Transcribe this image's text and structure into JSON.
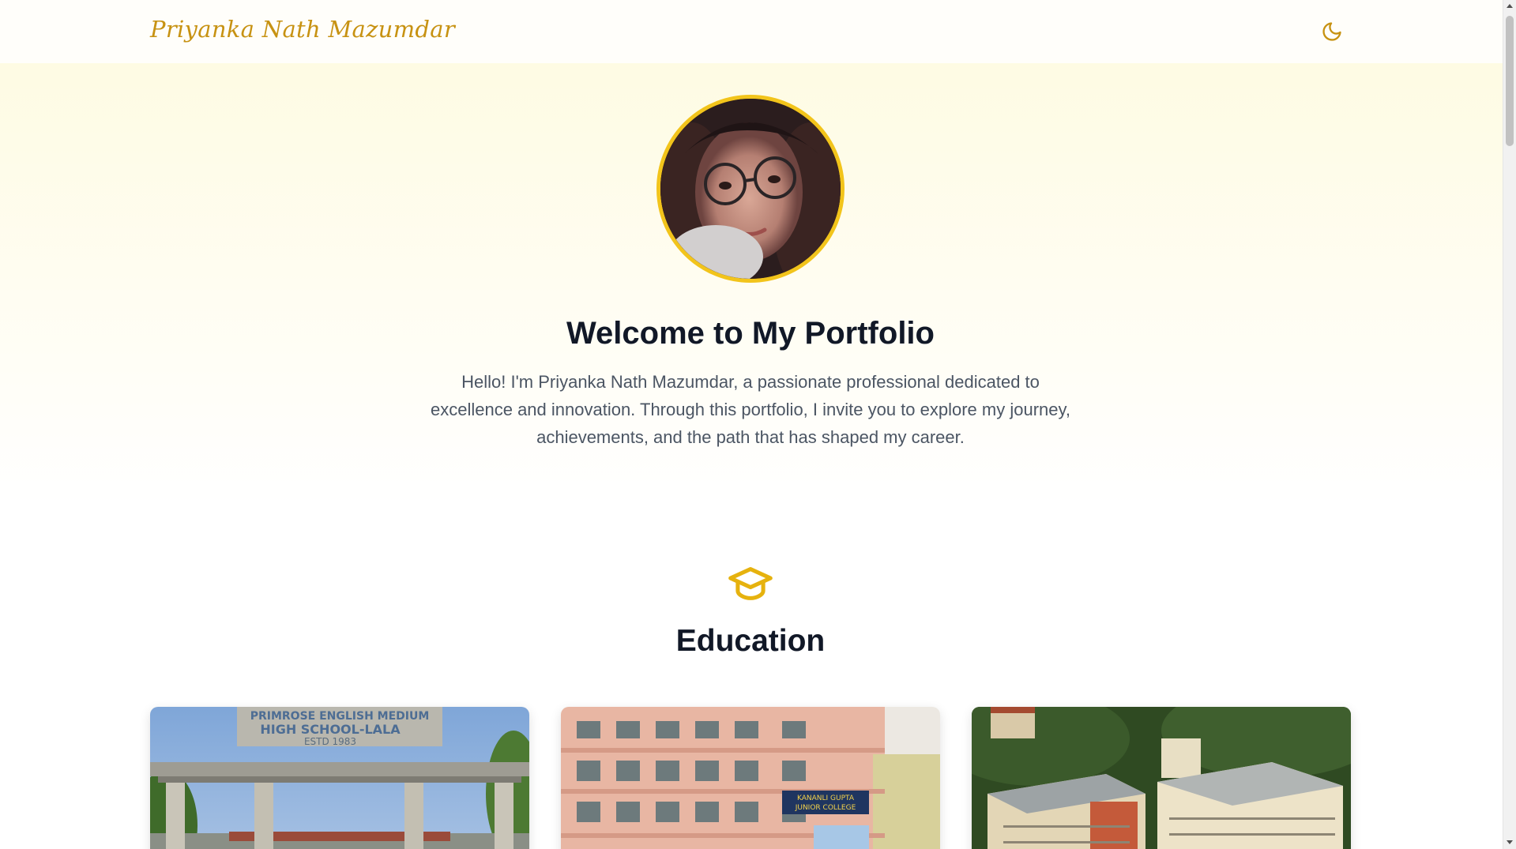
{
  "header": {
    "brand": "Priyanka Nath Mazumdar",
    "theme_toggle_icon": "moon-icon"
  },
  "hero": {
    "avatar_icon": "profile-photo",
    "title": "Welcome to My Portfolio",
    "intro": "Hello! I'm Priyanka Nath Mazumdar, a passionate professional dedicated to excellence and innovation. Through this portfolio, I invite you to explore my journey, achievements, and the path that has shaped my career."
  },
  "education": {
    "icon": "graduation-cap-icon",
    "title": "Education",
    "cards": [
      {
        "image": "school-gate-photo",
        "sign_lines": [
          "PRIMROSE ENGLISH MEDIUM",
          "HIGH SCHOOL-LALA",
          "ESTD 1983"
        ]
      },
      {
        "image": "junior-college-building-photo",
        "sign_lines": [
          "KANANLI GUPTA",
          "JUNIOR COLLEGE"
        ]
      },
      {
        "image": "university-campus-aerial-photo"
      }
    ]
  },
  "colors": {
    "accent": "#c79212",
    "avatar_ring": "#f2c41b",
    "heading": "#111827",
    "body_text": "#4b5563"
  }
}
